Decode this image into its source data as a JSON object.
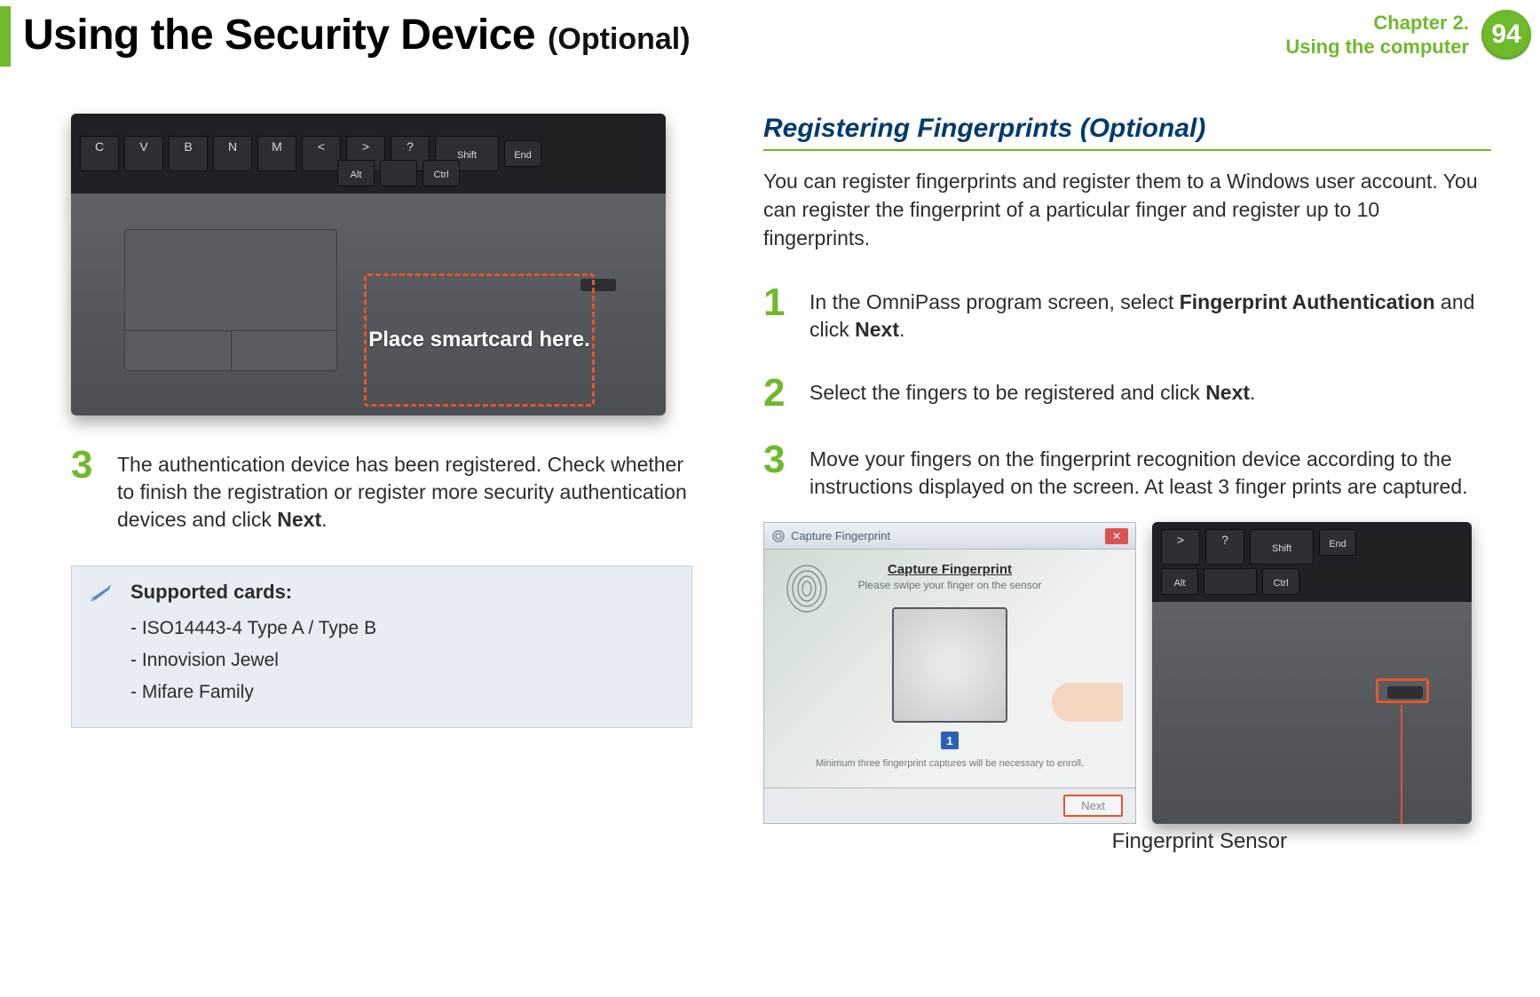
{
  "header": {
    "title": "Using the Security Device",
    "optional": "(Optional)",
    "chapter_line1": "Chapter 2.",
    "chapter_line2": "Using the computer",
    "page_number": "94"
  },
  "left": {
    "keys_top": [
      "C",
      "V",
      "B",
      "N",
      "M",
      "<",
      ">",
      "?",
      "Shift",
      "End"
    ],
    "keys_bottom": [
      "Alt",
      "",
      "Ctrl"
    ],
    "smartcard_label": "Place smartcard here.",
    "step3_num": "3",
    "step3_text_a": "The authentication device has been registered. Check whether to finish the registration or register more security authentication devices and click ",
    "step3_text_b": "Next",
    "step3_text_c": ".",
    "note_title": "Supported cards:",
    "note_items": [
      "- ISO14443-4 Type A / Type B",
      "- Innovision Jewel",
      "- Mifare Family"
    ]
  },
  "right": {
    "section_title": "Registering Fingerprints (Optional)",
    "intro": "You can register fingerprints and register them to a Windows user account. You can register the fingerprint of a particular finger and register up to 10 fingerprints.",
    "step1_num": "1",
    "step1_a": "In the OmniPass program screen, select ",
    "step1_b": "Fingerprint Authentication",
    "step1_c": " and click ",
    "step1_d": "Next",
    "step1_e": ".",
    "step2_num": "2",
    "step2_a": "Select the fingers to be registered and click ",
    "step2_b": "Next",
    "step2_c": ".",
    "step3_num": "3",
    "step3_text": "Move your fingers on the fingerprint recognition device according to the instructions displayed on the screen. At least 3 finger prints are captured.",
    "dialog": {
      "title": "Capture Fingerprint",
      "heading": "Capture Fingerprint",
      "sub": "Please swipe your finger on the sensor",
      "counter": "1",
      "footnote": "Minimum three fingerprint captures will be necessary to enroll.",
      "next": "Next"
    },
    "fp_label": "Fingerprint Sensor",
    "corner_keys": [
      ">",
      "?",
      "Shift",
      "End",
      "Alt",
      "Ctrl"
    ]
  }
}
